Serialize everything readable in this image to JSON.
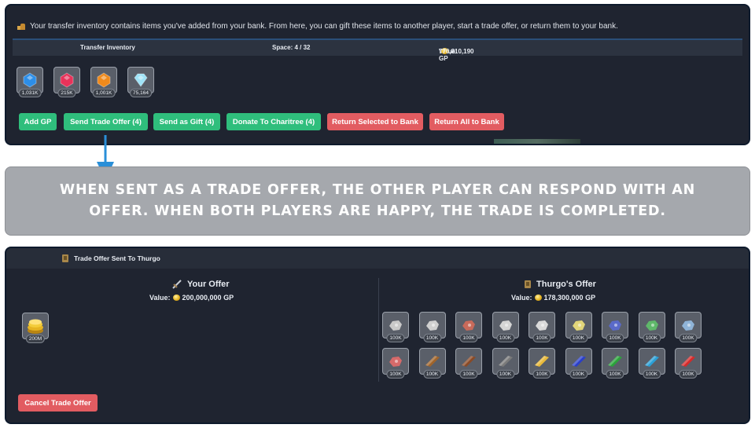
{
  "transfer": {
    "info_text": "Your transfer inventory contains items you've added from your bank. From here, you can gift these items to another player, start a trade offer, or return them to your bank.",
    "title": "Transfer Inventory",
    "space": "Space: 4 / 32",
    "value_label": "Value:",
    "value_amount": "776,810,190 GP",
    "items": [
      {
        "icon": "blue-gem-icon",
        "qty": "1,031K",
        "color": "#2d8ee8"
      },
      {
        "icon": "red-gem-icon",
        "qty": "215K",
        "color": "#e8335a"
      },
      {
        "icon": "orange-gem-icon",
        "qty": "1,001K",
        "color": "#f08a1c"
      },
      {
        "icon": "diamond-icon",
        "qty": "75,164",
        "color": "#9fe3f7"
      }
    ],
    "buttons": {
      "add_gp": "Add GP",
      "send_trade": "Send Trade Offer (4)",
      "send_gift": "Send as Gift (4)",
      "donate": "Donate To Charitree (4)",
      "return_selected": "Return Selected to Bank",
      "return_all": "Return All to Bank"
    },
    "colors": {
      "green": "#2fbe7c",
      "red": "#e25c61",
      "panel": "#1f2430"
    }
  },
  "banner": {
    "text": "When sent as a trade offer, the other player can respond with an offer. When both players are happy, the trade is completed."
  },
  "trade": {
    "title": "Trade Offer Sent To Thurgo",
    "your_offer": {
      "heading": "Your Offer",
      "value_label": "Value:",
      "value_amount": "200,000,000 GP",
      "items": [
        {
          "icon": "coins-icon",
          "qty": "200M"
        }
      ]
    },
    "their_offer": {
      "heading": "Thurgo's Offer",
      "value_label": "Value:",
      "value_amount": "178,300,000 GP",
      "items": [
        {
          "icon": "ore-icon",
          "qty": "100K",
          "color": "#c9c9c9"
        },
        {
          "icon": "ore-icon",
          "qty": "100K",
          "color": "#d0d0d0"
        },
        {
          "icon": "ore-icon",
          "qty": "100K",
          "color": "#c86a5a"
        },
        {
          "icon": "ore-icon",
          "qty": "100K",
          "color": "#d5d5d5"
        },
        {
          "icon": "ore-icon",
          "qty": "100K",
          "color": "#dadada"
        },
        {
          "icon": "ore-icon",
          "qty": "100K",
          "color": "#e2d67a"
        },
        {
          "icon": "ore-icon",
          "qty": "100K",
          "color": "#5a6ac9"
        },
        {
          "icon": "ore-icon",
          "qty": "100K",
          "color": "#5fb86a"
        },
        {
          "icon": "ore-icon",
          "qty": "100K",
          "color": "#8fb4d8"
        },
        {
          "icon": "ore-icon",
          "qty": "100K",
          "color": "#d66a6a"
        },
        {
          "icon": "bar-icon",
          "qty": "100K",
          "color": "#a0642a"
        },
        {
          "icon": "bar-icon",
          "qty": "100K",
          "color": "#8a4a26"
        },
        {
          "icon": "bar-icon",
          "qty": "100K",
          "color": "#7a7a7a"
        },
        {
          "icon": "bar-icon",
          "qty": "100K",
          "color": "#e8b93a"
        },
        {
          "icon": "bar-icon",
          "qty": "100K",
          "color": "#2a3fc8"
        },
        {
          "icon": "bar-icon",
          "qty": "100K",
          "color": "#2aa33a"
        },
        {
          "icon": "bar-icon",
          "qty": "100K",
          "color": "#2a9fd6"
        },
        {
          "icon": "bar-icon",
          "qty": "100K",
          "color": "#d42a2a"
        }
      ]
    },
    "cancel_button": "Cancel Trade Offer"
  }
}
